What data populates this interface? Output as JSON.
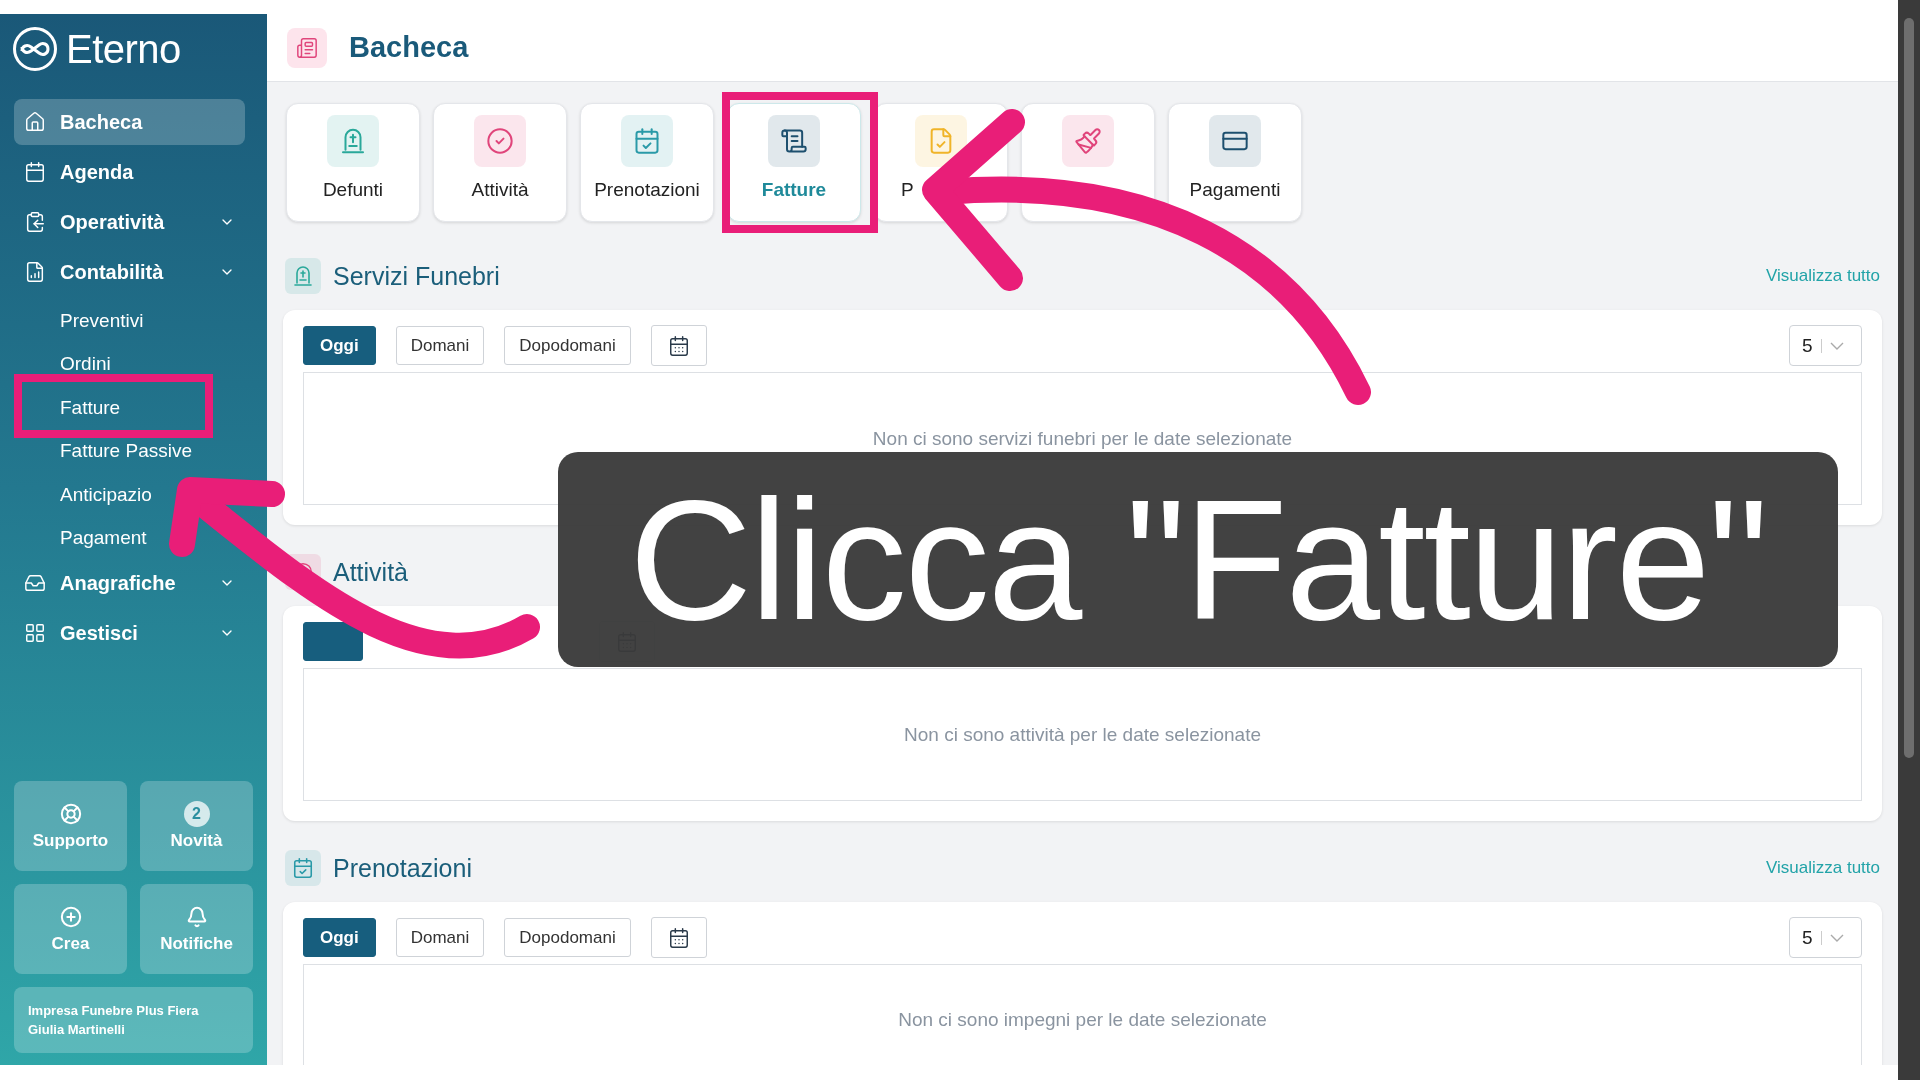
{
  "sidebar": {
    "brand": "Eterno",
    "items": [
      {
        "label": "Bacheca",
        "kind": "link",
        "selected": true
      },
      {
        "label": "Agenda",
        "kind": "link",
        "selected": false
      },
      {
        "label": "Operatività",
        "kind": "group",
        "selected": false
      },
      {
        "label": "Contabilità",
        "kind": "group",
        "selected": false,
        "children": [
          {
            "label": "Preventivi"
          },
          {
            "label": "Ordini"
          },
          {
            "label": "Fatture"
          },
          {
            "label": "Fatture Passive"
          },
          {
            "label": "Anticipazio"
          },
          {
            "label": "Pagament"
          }
        ]
      },
      {
        "label": "Anagrafiche",
        "kind": "group",
        "selected": false
      },
      {
        "label": "Gestisci",
        "kind": "group",
        "selected": false
      }
    ],
    "quick_buttons": [
      {
        "label": "Supporto"
      },
      {
        "label": "Novità"
      },
      {
        "label": "Crea"
      },
      {
        "label": "Notifiche"
      }
    ],
    "news_count": "2",
    "account": {
      "company": "Impresa Funebre Plus Fiera",
      "user": "Giulia Martinelli"
    }
  },
  "header": {
    "title": "Bacheca"
  },
  "tiles": [
    {
      "label": "Defunti",
      "selected": false,
      "color": "#2aa89a"
    },
    {
      "label": "Attività",
      "selected": false,
      "color": "#e0457b"
    },
    {
      "label": "Prenotazioni",
      "selected": false,
      "color": "#2a9aa8"
    },
    {
      "label": "Fatture",
      "selected": true,
      "color": "#1d4f6e"
    },
    {
      "label": "P",
      "selected": false,
      "color": "#f0b429"
    },
    {
      "selected": false,
      "color": "#e0457b"
    },
    {
      "label": "Pagamenti",
      "selected": false,
      "color": "#1d4f6e"
    }
  ],
  "sections": [
    {
      "title": "Servizi Funebri",
      "link": "Visualizza tutto",
      "buttons": [
        {
          "label": "Oggi",
          "selected": true
        },
        {
          "label": "Domani",
          "selected": false
        },
        {
          "label": "Dopodomani",
          "selected": false
        }
      ],
      "page_size": "5",
      "empty_message": "Non ci sono servizi funebri per le date selezionate"
    },
    {
      "title": "Attività",
      "buttons": [
        {
          "selected": true
        }
      ],
      "empty_message": "Non ci sono attività per le date selezionate"
    },
    {
      "title": "Prenotazioni",
      "link": "Visualizza tutto",
      "buttons": [
        {
          "label": "Oggi",
          "selected": true
        },
        {
          "label": "Domani",
          "selected": false
        },
        {
          "label": "Dopodomani",
          "selected": false
        }
      ],
      "page_size": "5",
      "empty_message": "Non ci sono impegni per le date selezionate"
    }
  ],
  "annotation": {
    "caption": "Clicca \"Fatture\""
  }
}
